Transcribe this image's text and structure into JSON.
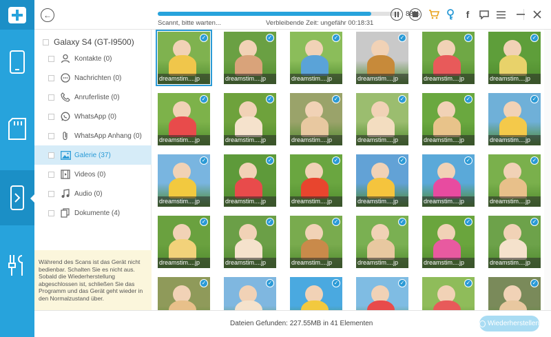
{
  "window": {
    "back_icon": "back-arrow-icon",
    "pause_icon": "pause-icon",
    "stop_icon": "stop-icon",
    "cart_icon": "cart-icon",
    "key_icon": "key-icon",
    "facebook_icon": "facebook-icon",
    "chat_icon": "chat-icon",
    "menu_icon": "menu-icon",
    "minimize_icon": "minimize-icon",
    "close_icon": "close-icon"
  },
  "scan": {
    "progress_percent": 88,
    "progress_label": "88%",
    "status_text": "Scannt, bitte warten...",
    "remaining_text": "Verbleibende Zeit: ungefähr 00:18:31"
  },
  "rail": {
    "items": [
      {
        "name": "phone-icon"
      },
      {
        "name": "sdcard-icon"
      },
      {
        "name": "device-recovery-icon"
      },
      {
        "name": "tools-icon"
      }
    ]
  },
  "sidebar": {
    "device_name": "Galaxy S4 (GT-I9500)",
    "categories": [
      {
        "label": "Kontakte (0)",
        "icon": "contacts-icon",
        "active": false
      },
      {
        "label": "Nachrichten (0)",
        "icon": "messages-icon",
        "active": false
      },
      {
        "label": "Anruferliste (0)",
        "icon": "call-log-icon",
        "active": false
      },
      {
        "label": "WhatsApp (0)",
        "icon": "whatsapp-icon",
        "active": false
      },
      {
        "label": "WhatsApp Anhang (0)",
        "icon": "attachment-icon",
        "active": false
      },
      {
        "label": "Galerie (37)",
        "icon": "gallery-icon",
        "active": true
      },
      {
        "label": "Videos (0)",
        "icon": "video-icon",
        "active": false
      },
      {
        "label": "Audio (0)",
        "icon": "audio-icon",
        "active": false
      },
      {
        "label": "Dokumente (4)",
        "icon": "documents-icon",
        "active": false
      }
    ],
    "note": "Während des Scans ist das Gerät nicht bedienbar. Schalten Sie es nicht aus. Sobald die Wiederherstellung abgeschlossen ist, schließen Sie das Programm und das Gerät geht wieder in den Normalzustand über."
  },
  "gallery": {
    "caption": "dreamstim....jp",
    "tiles": [
      {
        "bg": "#7fb24f",
        "accent": "#f0c64b"
      },
      {
        "bg": "#6aa043",
        "accent": "#d9a37a"
      },
      {
        "bg": "#8bbd5a",
        "accent": "#5aa3d8"
      },
      {
        "bg": "#c9c9c9",
        "accent": "#c78a3a"
      },
      {
        "bg": "#6fa845",
        "accent": "#e85a5a"
      },
      {
        "bg": "#5e9e3a",
        "accent": "#e8d26a"
      },
      {
        "bg": "#7db24a",
        "accent": "#e84b4b"
      },
      {
        "bg": "#6ea23c",
        "accent": "#f5e2cc"
      },
      {
        "bg": "#9aa36a",
        "accent": "#e8c8a0"
      },
      {
        "bg": "#9bbd6f",
        "accent": "#f3ddc0"
      },
      {
        "bg": "#6aa83f",
        "accent": "#e8c38a"
      },
      {
        "bg": "#6fb0d8",
        "accent": "#f4c94a"
      },
      {
        "bg": "#79b5e0",
        "accent": "#f2c93f"
      },
      {
        "bg": "#5e9a3a",
        "accent": "#e84b4b"
      },
      {
        "bg": "#6aa640",
        "accent": "#e8452e"
      },
      {
        "bg": "#62a2d6",
        "accent": "#f5c43d"
      },
      {
        "bg": "#5aa9d9",
        "accent": "#e84ba0"
      },
      {
        "bg": "#7ab04c",
        "accent": "#e8c08a"
      },
      {
        "bg": "#6aa13f",
        "accent": "#f2d27a"
      },
      {
        "bg": "#6b9f47",
        "accent": "#f5e2cc"
      },
      {
        "bg": "#79ab4e",
        "accent": "#c98a4a"
      },
      {
        "bg": "#7ab052",
        "accent": "#e8c8a0"
      },
      {
        "bg": "#6aa53d",
        "accent": "#e85aa0"
      },
      {
        "bg": "#6da24a",
        "accent": "#f5e2cc"
      },
      {
        "bg": "#8f9a5a",
        "accent": "#e8c08a"
      },
      {
        "bg": "#7fb7e0",
        "accent": "#f5e2cc"
      },
      {
        "bg": "#4aa9e0",
        "accent": "#f2c93f"
      },
      {
        "bg": "#7fbce3",
        "accent": "#e84b4b"
      },
      {
        "bg": "#8fbc5a",
        "accent": "#e85a5a"
      },
      {
        "bg": "#7a8a5a",
        "accent": "#e8c8a0"
      }
    ]
  },
  "footer": {
    "found_text": "Dateien Gefunden: 227.55MB in 41 Elementen",
    "restore_label": "Wiederherstellen"
  }
}
